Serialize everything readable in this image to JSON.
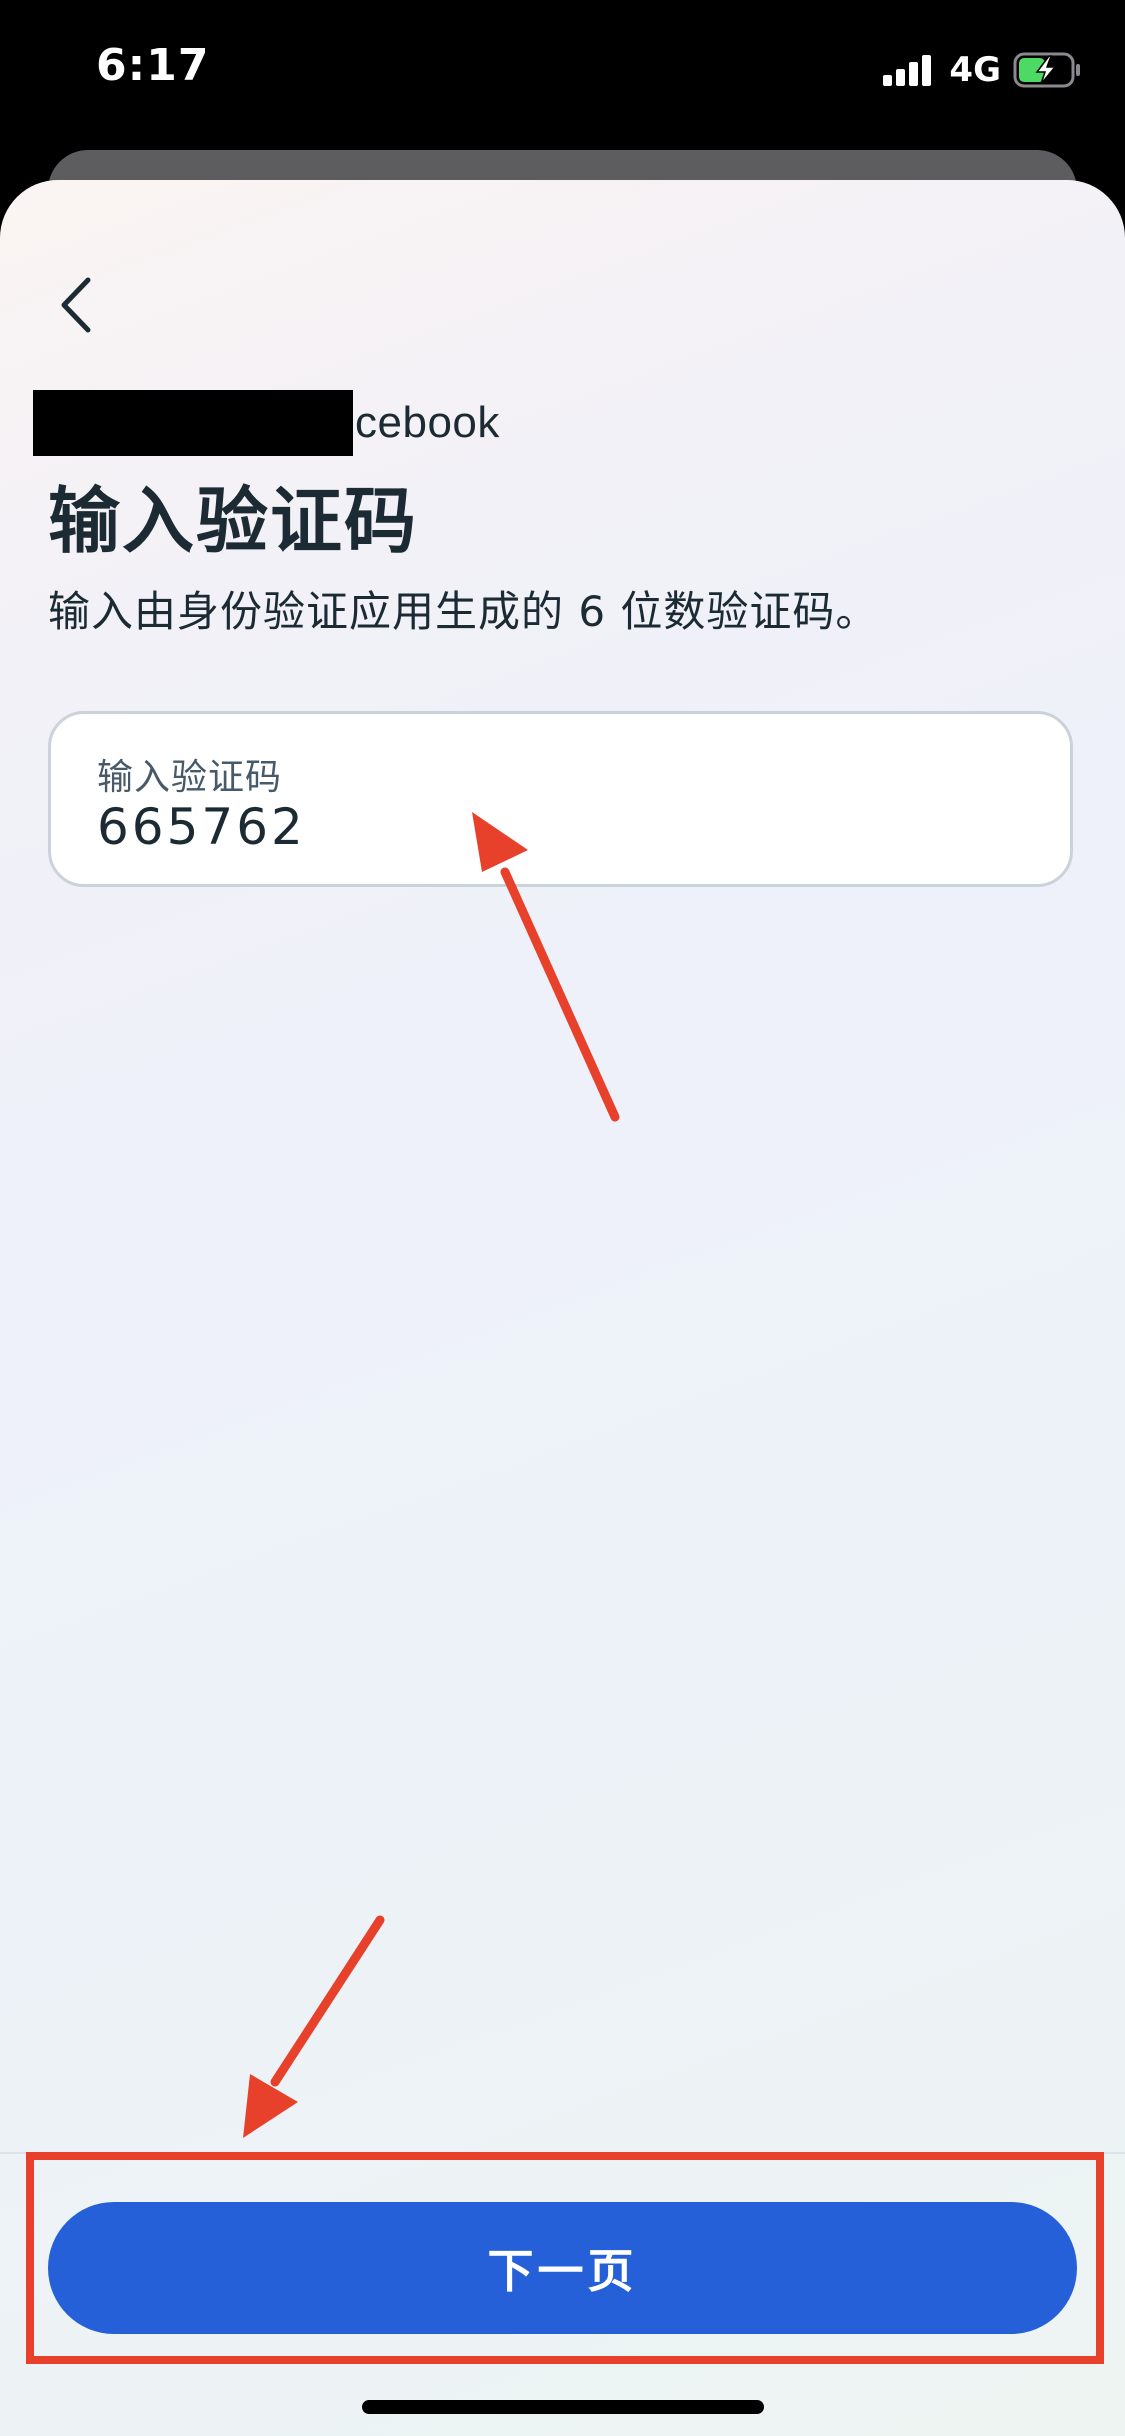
{
  "status_bar": {
    "time": "6:17",
    "network": "4G",
    "battery_state": "charging"
  },
  "header": {
    "back_icon": "chevron-left-icon",
    "brand_suffix": "cebook"
  },
  "main": {
    "title": "输入验证码",
    "subtitle": "输入由身份验证应用生成的 6 位数验证码。",
    "code_field": {
      "label": "输入验证码",
      "value": "665762"
    }
  },
  "footer": {
    "next_button_label": "下一页"
  },
  "annotations": {
    "color": "#e8412b"
  },
  "colors": {
    "primary_button": "#2660d8",
    "text_primary": "#1c2b33",
    "battery_charging": "#4cd964"
  }
}
